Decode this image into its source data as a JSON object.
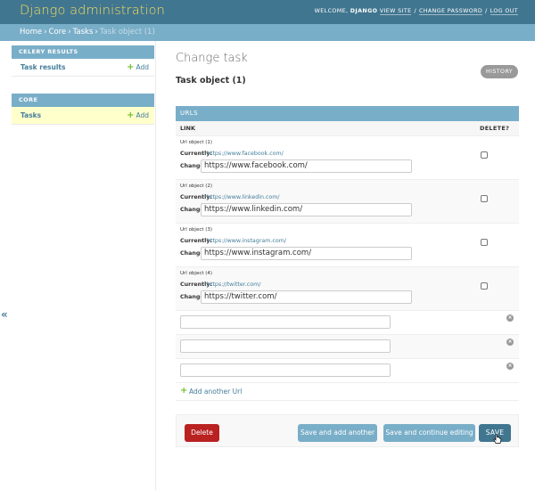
{
  "header": {
    "brand": "Django administration",
    "welcome": "WELCOME,",
    "username": "DJANGO",
    "links": [
      "VIEW SITE",
      "CHANGE PASSWORD",
      "LOG OUT"
    ]
  },
  "breadcrumbs": {
    "home": "Home",
    "app": "Core",
    "model": "Tasks",
    "current": "Task object (1)",
    "separator": "›"
  },
  "sidebar": {
    "collapse_icon": "«",
    "modules": [
      {
        "caption": "CELERY RESULTS",
        "items": [
          {
            "label": "Task results",
            "add": "Add"
          }
        ]
      },
      {
        "caption": "CORE",
        "items": [
          {
            "label": "Tasks",
            "add": "Add"
          }
        ]
      }
    ]
  },
  "main": {
    "title": "Change task",
    "object_title": "Task object (1)",
    "history": "HISTORY"
  },
  "inline": {
    "caption": "URLS",
    "col_link": "LINK",
    "col_delete": "DELETE?",
    "currently_label": "Currently:",
    "change_label": "Change:",
    "rows": [
      {
        "label": "Url object (1)",
        "current": "https://www.facebook.com/",
        "value": "https://www.facebook.com/"
      },
      {
        "label": "Url object (2)",
        "current": "https://www.linkedin.com/",
        "value": "https://www.linkedin.com/"
      },
      {
        "label": "Url object (3)",
        "current": "https://www.instagram.com/",
        "value": "https://www.instagram.com/"
      },
      {
        "label": "Url object (4)",
        "current": "https://twitter.com/",
        "value": "https://twitter.com/"
      }
    ],
    "remove_icon": "×",
    "add_another": "Add another Url",
    "plus": "+"
  },
  "submit": {
    "delete": "Delete",
    "save_add": "Save and add another",
    "save_continue": "Save and continue editing",
    "save": "SAVE"
  },
  "colors": {
    "header_bg": "#417690",
    "brand": "#f5dd5d",
    "breadcrumb_bg": "#79aec8",
    "delete_red": "#ba2121",
    "add_green": "#70bf2b",
    "current_highlight": "#ffffcc"
  }
}
